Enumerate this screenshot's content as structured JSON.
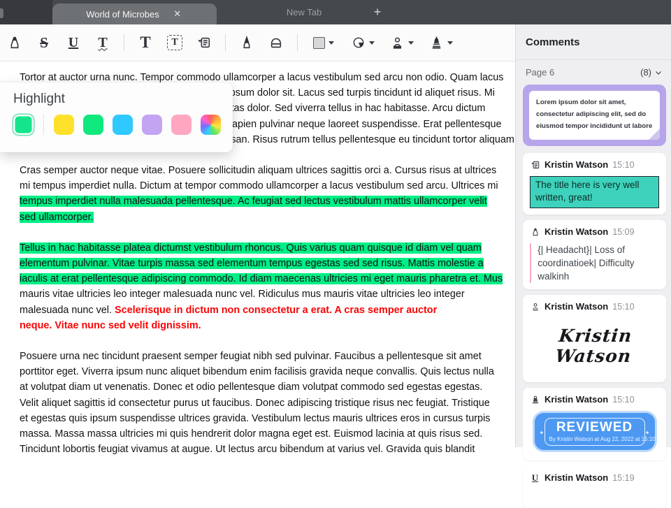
{
  "colors": {
    "highlight_green": "#00EE85",
    "red_text": "#F90505",
    "teal_note": "#3ED2BC",
    "purple_note": "#B7A5EB",
    "pink_bar": "#F8A9C4",
    "stamp_blue": "#4D99F2",
    "swatches": [
      "#14E58C",
      "#FFE12B",
      "#0FE87C",
      "#2FC9FF",
      "#C3A4F2",
      "#FFA6C1"
    ]
  },
  "tabbar": {
    "active_tab": "World of Microbes",
    "close_glyph": "✕",
    "inactive_tab": "New Tab",
    "new_tab_glyph": "+"
  },
  "toolbar": {
    "strike_glyph": "S",
    "underline_glyph": "U",
    "squiggly_glyph": "T",
    "text_glyph": "T",
    "textbox_glyph": "T"
  },
  "popup": {
    "title": "Highlight"
  },
  "document": {
    "p1": [
      "Tortor at auctor urna nunc. Tempor commodo ullamcorper a lacus vestibulum sed arcu non odio. Quam lacus",
      "suspendisse faucibus interdum posuere lorem ipsum dolor sit. Lacus sed turpis tincidunt id aliquet risus. Mi",
      "bibendum neque egestas congue quisque egestas dolor. Sed viverra tellus in hac habitasse. Arcu dictum",
      "varius duis at consectetur lorem donec massa sapien pulvinar neque laoreet suspendisse. Erat pellentesque",
      "adipiscing commodo elit at imperdiet dui accumsan. Risus rutrum tellus pellentesque eu tincidunt tortor aliquam."
    ],
    "p2_plain1": "Cras semper auctor neque vitae. Posuere sollicitudin aliquam ultrices sagittis orci a. Cursus risus at ultrices",
    "p2_plain2": "mi tempus imperdiet nulla. Dictum at tempor commodo ullamcorper a lacus vestibulum sed arcu. Ultrices mi",
    "p2_hl1": "tempus imperdiet nulla malesuada pellentesque. Ac feugiat sed lectus vestibulum mattis ullamcorper velit",
    "p2_hl2": "sed ullamcorper.",
    "p3_hl1": "Tellus in hac habitasse platea dictumst vestibulum rhoncus. Quis varius quam quisque id diam vel quam",
    "p3_hl2": "elementum pulvinar. Vitae turpis massa sed elementum tempus egestas sed sed risus. Mattis molestie a",
    "p3_hl3": "iaculis at erat pellentesque adipiscing commodo. Id diam maecenas ultricies mi eget mauris pharetra et. Mus",
    "p3_plain1": "mauris vitae ultricies leo integer malesuada nunc vel. Ridiculus mus mauris vitae ultricies leo integer",
    "p3_mix_plain": "malesuada nunc vel. ",
    "p3_red1": "Scelerisque in dictum non consectetur a erat. A cras semper auctor",
    "p3_red2": "neque. Vitae nunc sed velit dignissim.",
    "p4": [
      "Posuere urna nec tincidunt praesent semper feugiat nibh sed pulvinar. Faucibus a pellentesque sit amet",
      "porttitor eget. Viverra ipsum nunc aliquet bibendum enim facilisis gravida neque convallis. Quis lectus nulla",
      "at volutpat diam ut venenatis. Donec et odio pellentesque diam volutpat commodo sed egestas egestas.",
      "Velit aliquet sagittis id consectetur purus ut faucibus. Donec adipiscing tristique risus nec feugiat. Tristique",
      "et egestas quis ipsum suspendisse ultrices gravida. Vestibulum lectus mauris ultrices eros in cursus turpis",
      "massa. Massa massa ultricies mi quis hendrerit dolor magna eget est. Euismod lacinia at quis risus sed.",
      "Tincidunt lobortis feugiat vivamus at augue. Ut lectus arcu bibendum at varius vel. Gravida quis blandit"
    ]
  },
  "comments": {
    "title": "Comments",
    "page_label": "Page 6",
    "page_count": "(8)",
    "items": [
      {
        "type": "sticky-note",
        "text": "Lorem ipsum dolor sit amet, consectetur adipiscing elit, sed do eiusmod tempor incididunt ut labore"
      },
      {
        "type": "note",
        "author": "Kristin Watson",
        "time": "15:10",
        "text": "The title here is very well written, great!"
      },
      {
        "type": "highlight",
        "author": "Kristin Watson",
        "time": "15:09",
        "text": "{| Headacht}| Loss of coordinatioek| Difficulty walkinh"
      },
      {
        "type": "signature",
        "author": "Kristin Watson",
        "time": "15:10",
        "signature": "Kristin Watson"
      },
      {
        "type": "stamp",
        "author": "Kristin Watson",
        "time": "15:10",
        "stamp_title": "REVIEWED",
        "stamp_sub": "By Kristin Watson at Aug 22, 2022 at 15:10",
        "star_glyph": "✦"
      },
      {
        "type": "underline",
        "author": "Kristin Watson",
        "time": "15:19",
        "icon_glyph": "U"
      }
    ]
  }
}
